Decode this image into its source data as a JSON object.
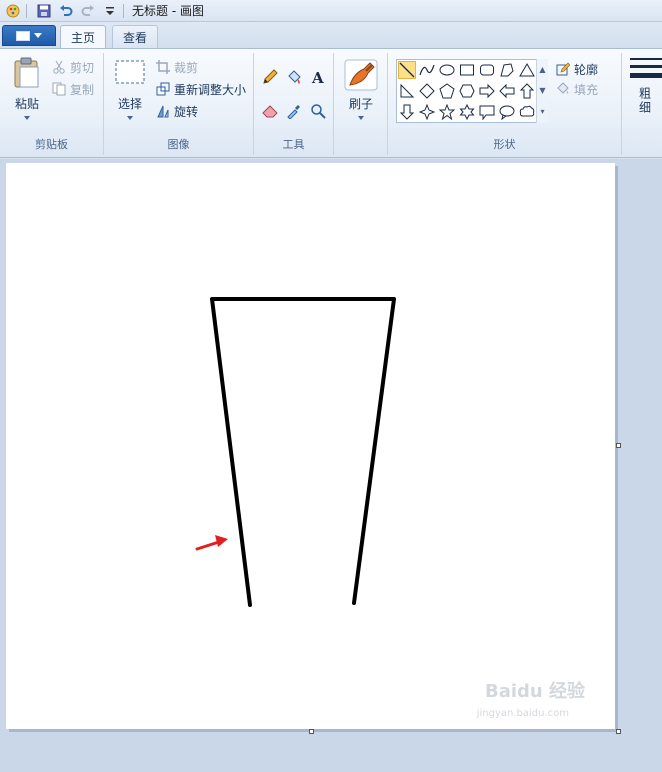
{
  "window": {
    "title": "无标题 - 画图"
  },
  "tabs": [
    {
      "label": "主页"
    },
    {
      "label": "查看"
    }
  ],
  "ribbon": {
    "clipboard": {
      "paste": "粘贴",
      "cut": "剪切",
      "copy": "复制",
      "label": "剪贴板"
    },
    "image": {
      "select": "选择",
      "crop": "裁剪",
      "resize": "重新调整大小",
      "rotate": "旋转",
      "label": "图像"
    },
    "tools": {
      "label": "工具"
    },
    "brushes": {
      "label": "刷子"
    },
    "shapes": {
      "label": "形状",
      "outline": "轮廓",
      "fill": "填充"
    },
    "size": {
      "label": "粗细"
    }
  },
  "watermark": {
    "brand": "Baidu 经验",
    "url": "jingyan.baidu.com"
  },
  "colors": {
    "accent": "#1e5aa8",
    "selected_shape": "#fddf88",
    "arrow": "#e02020"
  }
}
